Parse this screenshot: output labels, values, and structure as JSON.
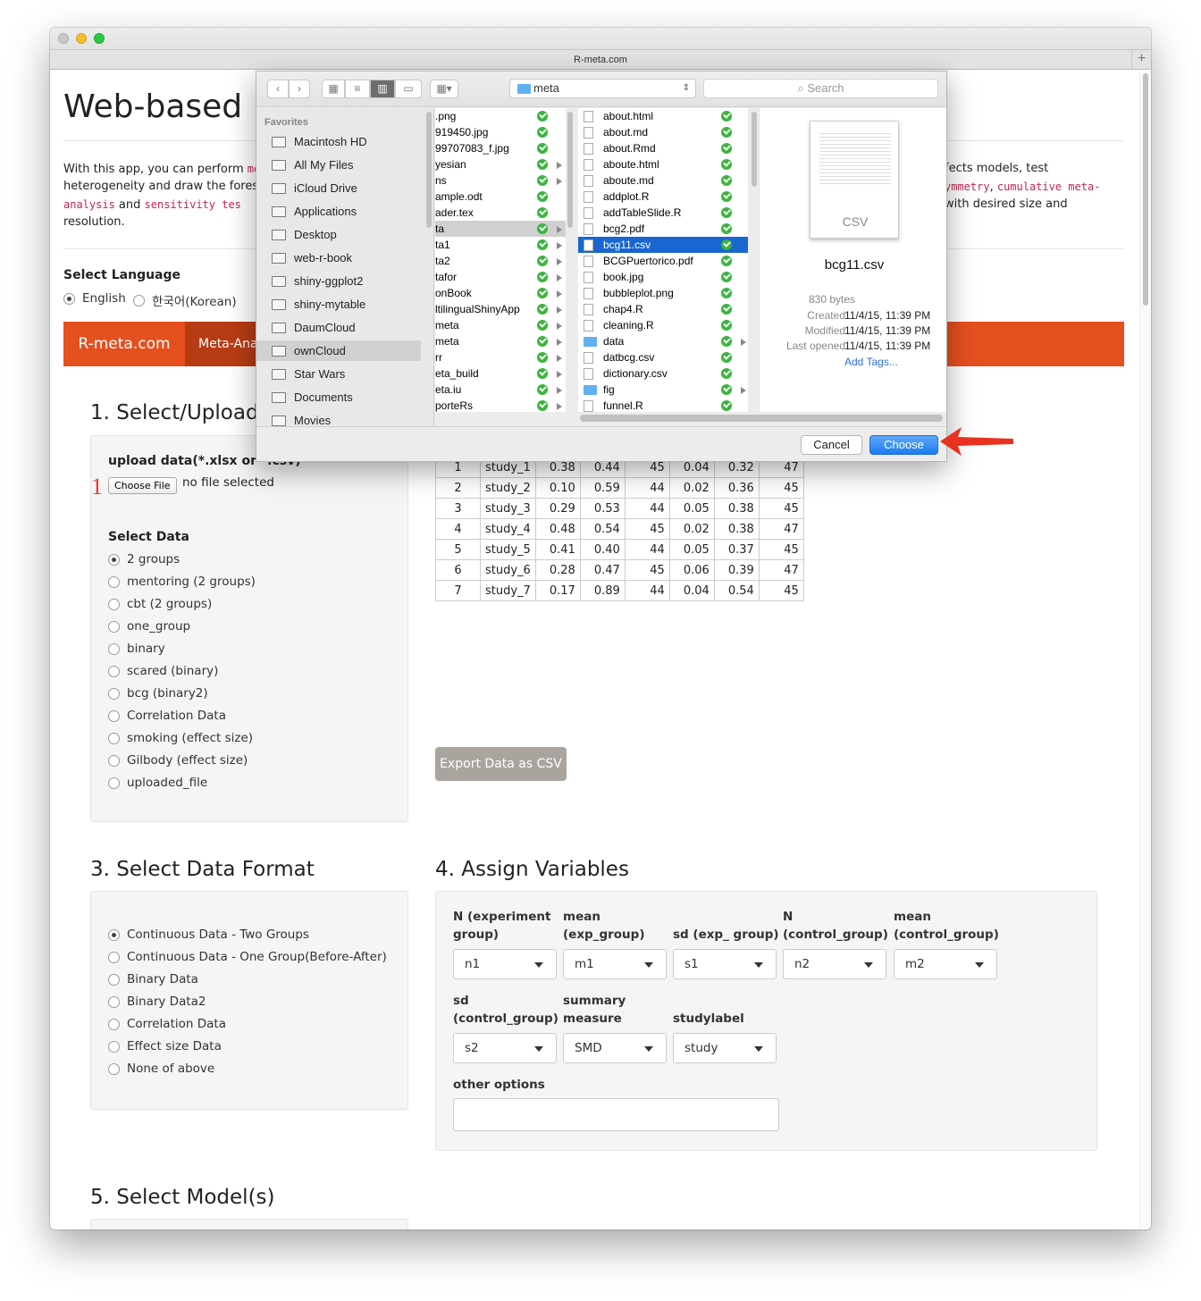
{
  "browser": {
    "tab_title": "R-meta.com"
  },
  "page": {
    "heading": "Web-based M",
    "intro": {
      "line1_a": "With this app, you can perform ",
      "line1_code": "me",
      "line1_right": "fects models, test",
      "line2_a": "heterogeneity and draw the forest",
      "line2_code1": "ymmetry",
      "line2_sep": ", ",
      "line2_code2": "cumulative meta-",
      "line3_code1": "analysis",
      "line3_and": " and ",
      "line3_code2": "sensitivity tes",
      "line3_right": "with desired size and",
      "line4": "resolution."
    },
    "language": {
      "label": "Select Language",
      "options": [
        {
          "label": "English",
          "selected": true
        },
        {
          "label": "한국어(Korean)",
          "selected": false
        }
      ]
    },
    "navbar": {
      "brand": "R-meta.com",
      "item": "Meta-Ana"
    },
    "section1": {
      "title": "1. Select/Upload",
      "upload_label": "upload data(*.xlsx or *.csv)",
      "step_marker": "1",
      "choose_file": "Choose File",
      "no_file": "no file selected",
      "select_data_label": "Select Data",
      "options": [
        {
          "label": "2 groups",
          "selected": true
        },
        {
          "label": "mentoring (2 groups)",
          "selected": false
        },
        {
          "label": "cbt (2 groups)",
          "selected": false
        },
        {
          "label": "one_group",
          "selected": false
        },
        {
          "label": "binary",
          "selected": false
        },
        {
          "label": "scared (binary)",
          "selected": false
        },
        {
          "label": "bcg (binary2)",
          "selected": false
        },
        {
          "label": "Correlation Data",
          "selected": false
        },
        {
          "label": "smoking (effect size)",
          "selected": false
        },
        {
          "label": "Gilbody (effect size)",
          "selected": false
        },
        {
          "label": "uploaded_file",
          "selected": false
        }
      ]
    },
    "data_table": {
      "rows": [
        [
          "1",
          "study_1",
          "0.38",
          "0.44",
          "45",
          "0.04",
          "0.32",
          "47"
        ],
        [
          "2",
          "study_2",
          "0.10",
          "0.59",
          "44",
          "0.02",
          "0.36",
          "45"
        ],
        [
          "3",
          "study_3",
          "0.29",
          "0.53",
          "44",
          "0.05",
          "0.38",
          "45"
        ],
        [
          "4",
          "study_4",
          "0.48",
          "0.54",
          "45",
          "0.02",
          "0.38",
          "47"
        ],
        [
          "5",
          "study_5",
          "0.41",
          "0.40",
          "44",
          "0.05",
          "0.37",
          "45"
        ],
        [
          "6",
          "study_6",
          "0.28",
          "0.47",
          "45",
          "0.06",
          "0.39",
          "47"
        ],
        [
          "7",
          "study_7",
          "0.17",
          "0.89",
          "44",
          "0.04",
          "0.54",
          "45"
        ]
      ],
      "export_button": "Export Data as CSV"
    },
    "section3": {
      "title": "3. Select Data Format",
      "options": [
        {
          "label": "Continuous Data - Two Groups",
          "selected": true
        },
        {
          "label": "Continuous Data - One Group(Before-After)",
          "selected": false
        },
        {
          "label": "Binary Data",
          "selected": false
        },
        {
          "label": "Binary Data2",
          "selected": false
        },
        {
          "label": "Correlation Data",
          "selected": false
        },
        {
          "label": "Effect size Data",
          "selected": false
        },
        {
          "label": "None of above",
          "selected": false
        }
      ]
    },
    "section4": {
      "title": "4. Assign Variables",
      "vars": [
        {
          "label1": "N (experiment",
          "label2": "group)",
          "value": "n1"
        },
        {
          "label1": "mean",
          "label2": "(exp_group)",
          "value": "m1"
        },
        {
          "label1": "",
          "label2": "sd (exp_ group)",
          "value": "s1"
        },
        {
          "label1": "N",
          "label2": "(control_group)",
          "value": "n2"
        },
        {
          "label1": "mean",
          "label2": "(control_group)",
          "value": "m2"
        },
        {
          "label1": "sd",
          "label2": "(control_group)",
          "value": "s2"
        },
        {
          "label1": "summary",
          "label2": "measure",
          "value": "SMD"
        },
        {
          "label1": "",
          "label2": "studylabel",
          "value": "study"
        }
      ],
      "other_options_label": "other options",
      "other_options_value": ""
    },
    "section5": {
      "title": "5. Select Model(s)"
    }
  },
  "dialog": {
    "location": "meta",
    "search_placeholder": "Search",
    "sidebar_header": "Favorites",
    "sidebar_items": [
      {
        "label": "Macintosh HD",
        "icon": "hard-drive-icon",
        "selected": false
      },
      {
        "label": "All My Files",
        "icon": "all-files-icon",
        "selected": false
      },
      {
        "label": "iCloud Drive",
        "icon": "cloud-icon",
        "selected": false
      },
      {
        "label": "Applications",
        "icon": "applications-icon",
        "selected": false
      },
      {
        "label": "Desktop",
        "icon": "folder-icon",
        "selected": false
      },
      {
        "label": "web-r-book",
        "icon": "folder-icon",
        "selected": false
      },
      {
        "label": "shiny-ggplot2",
        "icon": "folder-icon",
        "selected": false
      },
      {
        "label": "shiny-mytable",
        "icon": "folder-icon",
        "selected": false
      },
      {
        "label": "DaumCloud",
        "icon": "folder-icon",
        "selected": false
      },
      {
        "label": "ownCloud",
        "icon": "folder-icon",
        "selected": true
      },
      {
        "label": "Star Wars",
        "icon": "folder-icon",
        "selected": false
      },
      {
        "label": "Documents",
        "icon": "folder-icon",
        "selected": false
      },
      {
        "label": "Movies",
        "icon": "movies-icon",
        "selected": false
      }
    ],
    "column1": [
      {
        "name": ".png",
        "folder": false,
        "state": ""
      },
      {
        "name": "919450.jpg",
        "folder": false,
        "state": ""
      },
      {
        "name": "99707083_f.jpg",
        "folder": false,
        "state": ""
      },
      {
        "name": "yesian",
        "folder": true,
        "state": ""
      },
      {
        "name": "ns",
        "folder": true,
        "state": ""
      },
      {
        "name": "ample.odt",
        "folder": false,
        "state": ""
      },
      {
        "name": "ader.tex",
        "folder": false,
        "state": ""
      },
      {
        "name": "ta",
        "folder": true,
        "state": "highlight"
      },
      {
        "name": "ta1",
        "folder": true,
        "state": ""
      },
      {
        "name": "ta2",
        "folder": true,
        "state": ""
      },
      {
        "name": "tafor",
        "folder": true,
        "state": ""
      },
      {
        "name": "onBook",
        "folder": true,
        "state": ""
      },
      {
        "name": "ltilingualShinyApp",
        "folder": true,
        "state": ""
      },
      {
        "name": "meta",
        "folder": true,
        "state": ""
      },
      {
        "name": "meta",
        "folder": true,
        "state": ""
      },
      {
        "name": "rr",
        "folder": true,
        "state": ""
      },
      {
        "name": "eta_build",
        "folder": true,
        "state": ""
      },
      {
        "name": "eta.iu",
        "folder": true,
        "state": ""
      },
      {
        "name": "porteRs",
        "folder": true,
        "state": ""
      }
    ],
    "column2": [
      {
        "name": "about.html",
        "folder": false,
        "state": ""
      },
      {
        "name": "about.md",
        "folder": false,
        "state": ""
      },
      {
        "name": "about.Rmd",
        "folder": false,
        "state": ""
      },
      {
        "name": "aboute.html",
        "folder": false,
        "state": ""
      },
      {
        "name": "aboute.md",
        "folder": false,
        "state": ""
      },
      {
        "name": "addplot.R",
        "folder": false,
        "state": ""
      },
      {
        "name": "addTableSlide.R",
        "folder": false,
        "state": ""
      },
      {
        "name": "bcg2.pdf",
        "folder": false,
        "state": ""
      },
      {
        "name": "bcg11.csv",
        "folder": false,
        "state": "selected"
      },
      {
        "name": "BCGPuertorico.pdf",
        "folder": false,
        "state": ""
      },
      {
        "name": "book.jpg",
        "folder": false,
        "state": ""
      },
      {
        "name": "bubbleplot.png",
        "folder": false,
        "state": ""
      },
      {
        "name": "chap4.R",
        "folder": false,
        "state": ""
      },
      {
        "name": "cleaning.R",
        "folder": false,
        "state": ""
      },
      {
        "name": "data",
        "folder": true,
        "state": ""
      },
      {
        "name": "datbcg.csv",
        "folder": false,
        "state": ""
      },
      {
        "name": "dictionary.csv",
        "folder": false,
        "state": ""
      },
      {
        "name": "fig",
        "folder": true,
        "state": ""
      },
      {
        "name": "funnel.R",
        "folder": false,
        "state": ""
      }
    ],
    "preview": {
      "doc_type": "CSV",
      "filename": "bcg11.csv",
      "size": "830 bytes",
      "created_label": "Created",
      "created": "11/4/15, 11:39 PM",
      "modified_label": "Modified",
      "modified": "11/4/15, 11:39 PM",
      "opened_label": "Last opened",
      "opened": "11/4/15, 11:39 PM",
      "add_tags": "Add Tags..."
    },
    "cancel_button": "Cancel",
    "choose_button": "Choose"
  },
  "colors": {
    "navbar": "#e5501f",
    "navbar_active": "#b73c14",
    "selection_blue": "#1a66d0",
    "arrow_red": "#e8321f",
    "check_green": "#3ab53e"
  }
}
